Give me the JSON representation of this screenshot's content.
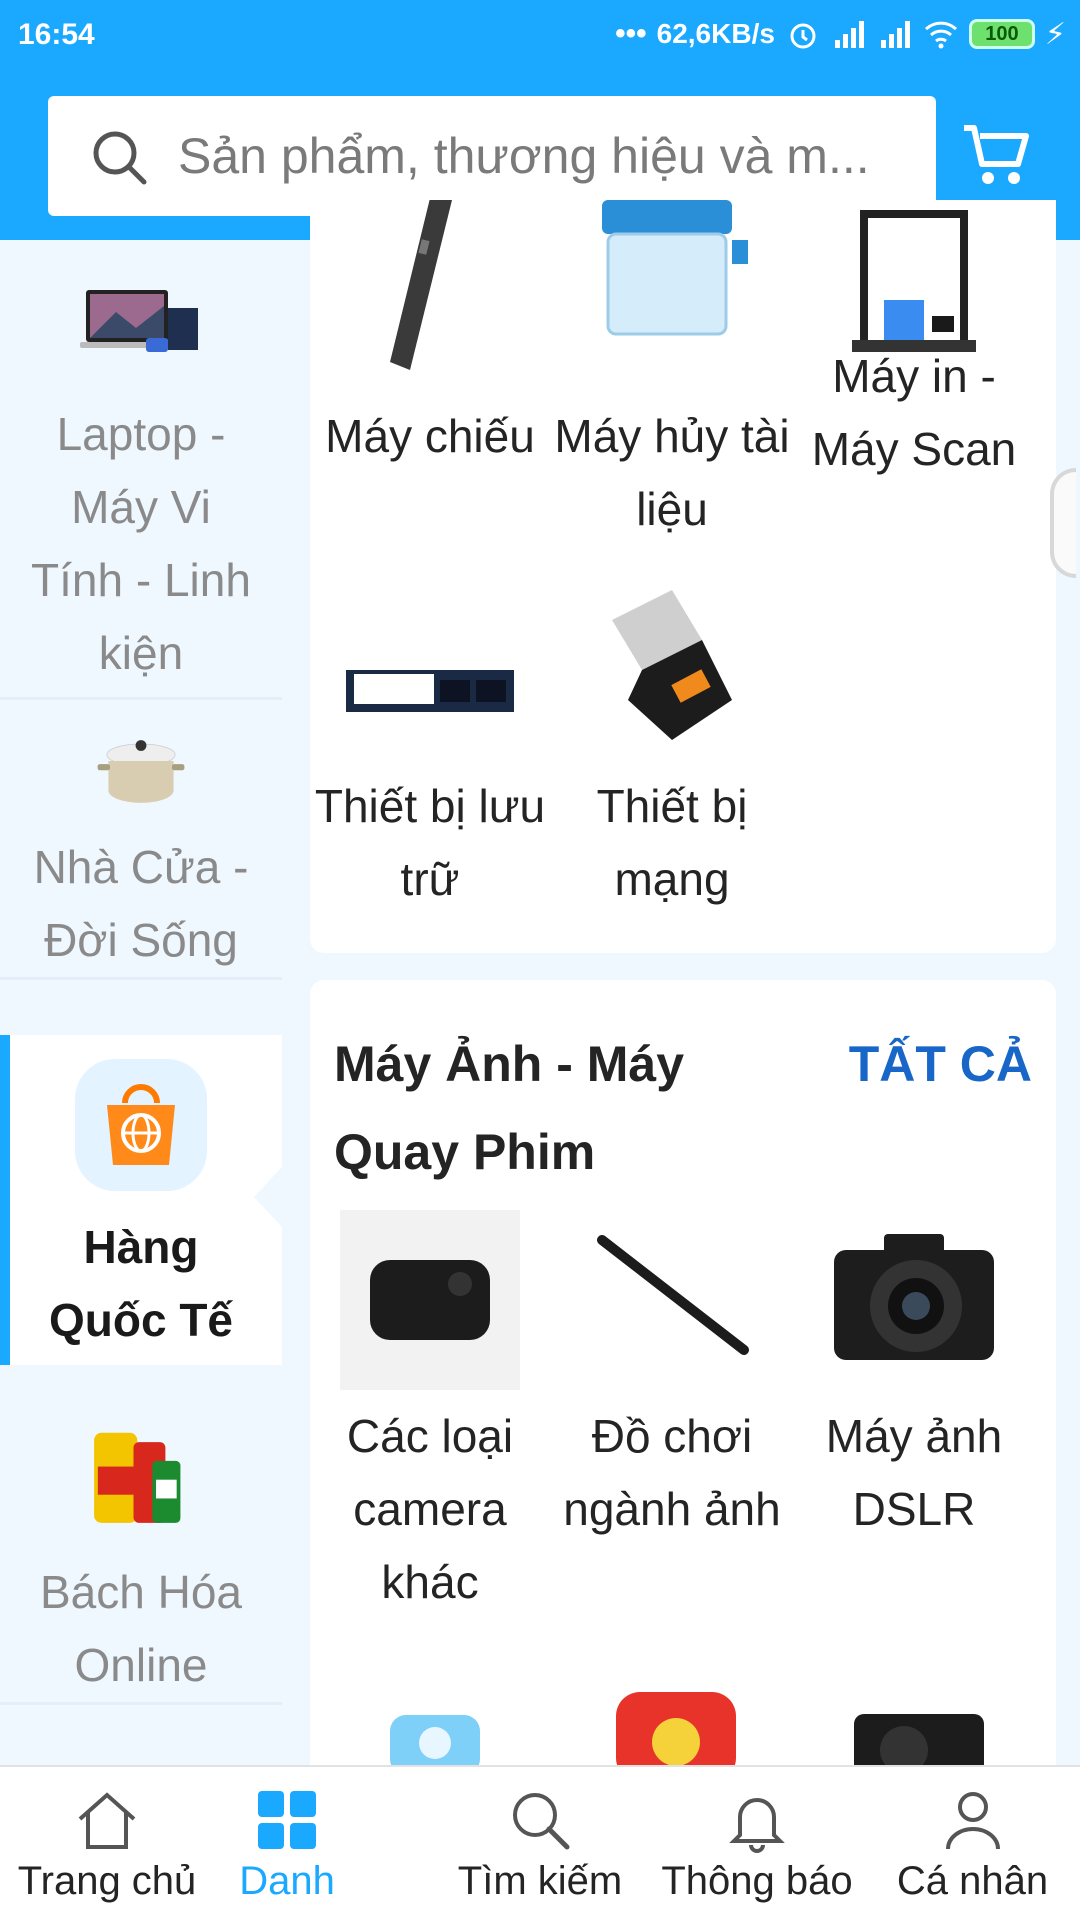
{
  "status_bar": {
    "time": "16:54",
    "net_speed": "62,6KB/s",
    "battery": "100"
  },
  "search": {
    "placeholder": "Sản phẩm, thương hiệu và m..."
  },
  "sidebar": {
    "items": [
      {
        "label": "Laptop - Máy Vi Tính - Linh kiện",
        "icon": "laptop-image"
      },
      {
        "label": "Nhà Cửa - Đời Sống",
        "icon": "cooking-pot-image"
      },
      {
        "label": "Hàng Quốc Tế",
        "icon": "global-shopping-bag-icon",
        "active": true
      },
      {
        "label": "Bách Hóa Online",
        "icon": "grocery-image"
      }
    ]
  },
  "sections": [
    {
      "tiles": [
        {
          "label": "Máy chiếu",
          "icon": "presenter-pointer-image"
        },
        {
          "label": "Máy hủy tài liệu",
          "icon": "paper-shredder-image"
        },
        {
          "label": "Máy in - Máy Scan",
          "icon": "3d-printer-image"
        },
        {
          "label": "Thiết bị lưu trữ",
          "icon": "ssd-image"
        },
        {
          "label": "Thiết bị mạng",
          "icon": "wifi-adapter-image"
        }
      ]
    },
    {
      "title": "Máy Ảnh - Máy Quay Phim",
      "see_all": "TẤT CẢ",
      "tiles": [
        {
          "label": "Các loại camera khác",
          "icon": "mini-camera-image"
        },
        {
          "label": "Đồ chơi ngành ảnh",
          "icon": "selfie-stick-image"
        },
        {
          "label": "Máy ảnh DSLR",
          "icon": "dslr-camera-image"
        }
      ]
    }
  ],
  "bottom_nav": [
    {
      "label": "Trang chủ",
      "icon": "home-icon"
    },
    {
      "label": "Danh",
      "icon": "grid-icon",
      "active": true
    },
    {
      "label": "Tìm kiếm",
      "icon": "search-icon"
    },
    {
      "label": "Thông báo",
      "icon": "bell-icon"
    },
    {
      "label": "Cá nhân",
      "icon": "user-icon"
    }
  ],
  "colors": {
    "primary": "#1ba8ff",
    "see_all": "#1867c8",
    "sidebar_bg": "#eff7ff"
  }
}
